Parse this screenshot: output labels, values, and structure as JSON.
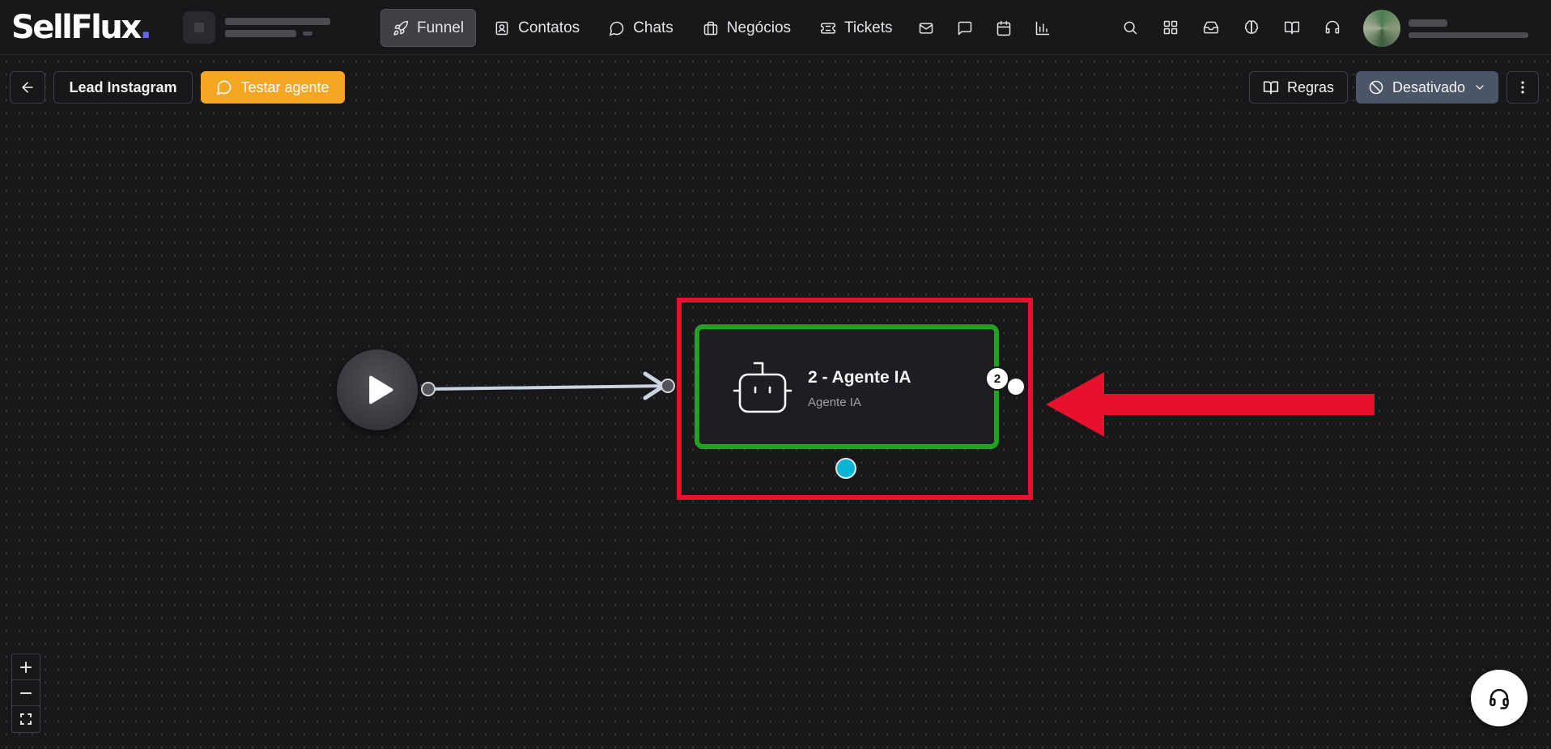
{
  "brand": {
    "logo_text": "SellFlux",
    "logo_dot": ".",
    "accent": "#6366f1"
  },
  "nav": {
    "items": [
      {
        "label": "Funnel",
        "icon": "rocket-icon",
        "active": true
      },
      {
        "label": "Contatos",
        "icon": "contact-icon"
      },
      {
        "label": "Chats",
        "icon": "chat-bubble-icon"
      },
      {
        "label": "Negócios",
        "icon": "briefcase-icon"
      },
      {
        "label": "Tickets",
        "icon": "ticket-icon"
      }
    ],
    "icon_items": [
      "mail-icon",
      "message-square-icon",
      "calendar-icon",
      "bar-chart-icon"
    ]
  },
  "header_right_icons": [
    "search-icon",
    "apps-grid-icon",
    "inbox-icon",
    "brain-icon",
    "book-open-icon",
    "headset-icon"
  ],
  "toolbar": {
    "back_icon": "arrow-left-icon",
    "flow_name": "Lead Instagram",
    "test_label": "Testar agente",
    "rules_label": "Regras",
    "status_label": "Desativado",
    "more_icon": "more-vertical-icon"
  },
  "flow": {
    "start_node_icon": "play-icon",
    "agent_node": {
      "title": "2 - Agente IA",
      "subtitle": "Agente IA",
      "icon": "robot-icon",
      "badge": "2"
    }
  },
  "colors": {
    "canvas": "#18181b",
    "test_button": "#f5a623",
    "status_button": "#4a5568",
    "node_border": "#22a122",
    "highlight": "#e8112d",
    "bottom_handle": "#06b6d4"
  }
}
